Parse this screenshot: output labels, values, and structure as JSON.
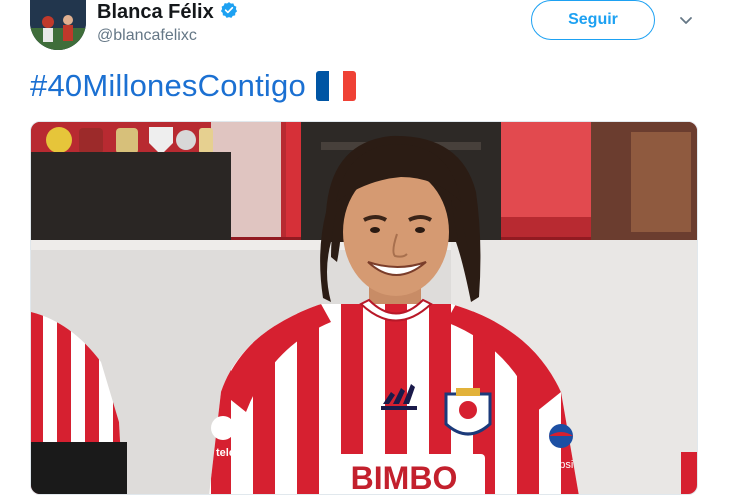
{
  "user": {
    "name": "Blanca Félix",
    "handle": "@blancafelixc",
    "verified": true
  },
  "actions": {
    "follow_label": "Seguir"
  },
  "tweet": {
    "hashtag": "#40MillonesContigo",
    "emoji": "french-flag"
  },
  "media": {
    "jersey_sponsor": "BIMBO",
    "sleeve_text": "telcel",
    "badge_text": "pepsi"
  },
  "colors": {
    "accent_blue": "#1da1f2",
    "hashtag_blue": "#1b70d2",
    "jersey_red": "#d62030",
    "flag_blue": "#0055a4",
    "flag_red": "#ef4135"
  },
  "icons": [
    "verified-icon",
    "chevron-down-icon"
  ]
}
